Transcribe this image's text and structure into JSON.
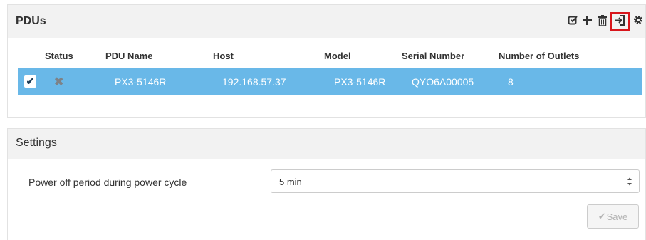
{
  "pdus": {
    "title": "PDUs",
    "toolbar": [
      {
        "icon": "edit-icon",
        "glyph": "☑"
      },
      {
        "icon": "plus-icon",
        "glyph": "✚"
      },
      {
        "icon": "trash-icon",
        "glyph": "🗑"
      },
      {
        "icon": "sign-in-icon",
        "glyph": "→"
      },
      {
        "icon": "gear-icon",
        "glyph": "⚙"
      }
    ],
    "columns": {
      "status": "Status",
      "name": "PDU Name",
      "host": "Host",
      "model": "Model",
      "serial": "Serial Number",
      "outlets": "Number of Outlets"
    },
    "rows": [
      {
        "checked": "✔",
        "status": "✖",
        "name": "PX3-5146R",
        "host": "192.168.57.37",
        "model": "PX3-5146R",
        "serial": "QYO6A00005",
        "outlets": "8"
      }
    ],
    "row_highlight_color": "#69b8e8"
  },
  "settings": {
    "title": "Settings",
    "power_off_label": "Power off period during power cycle",
    "power_off_value": "5 min",
    "save_label": "Save",
    "save_check": "✔"
  },
  "accent_color": "#d8161c"
}
